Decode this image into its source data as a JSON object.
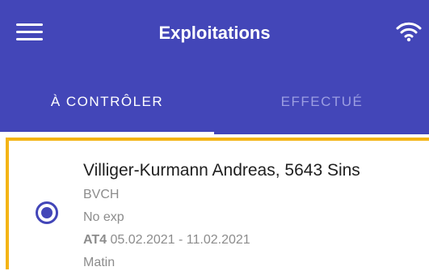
{
  "header": {
    "title": "Exploitations",
    "menu_icon": "hamburger-menu-icon",
    "status_icon": "wifi-icon"
  },
  "tabs": [
    {
      "label": "À CONTRÔLER",
      "active": true
    },
    {
      "label": "EFFECTUÉ",
      "active": false
    }
  ],
  "list": {
    "items": [
      {
        "title": "Villiger-Kurmann Andreas, 5643 Sins",
        "line1": "BVCH",
        "line2": "No exp",
        "code": "AT4",
        "dates": "05.02.2021 - 11.02.2021",
        "line4": "Matin",
        "selected": true
      }
    ]
  },
  "colors": {
    "primary": "#4346b8",
    "tab_inactive": "#9c9ee2",
    "highlight_border": "#f4b414",
    "text_dark": "#1f1f1f",
    "text_muted": "#8c8c8c"
  }
}
